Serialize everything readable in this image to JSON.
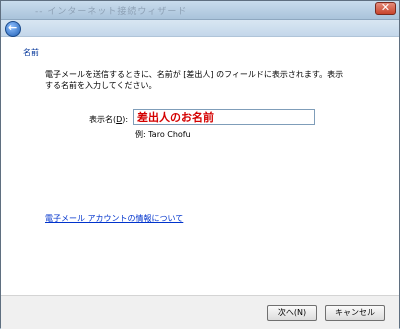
{
  "window": {
    "title_ghost": "-- インターネット接続ウィザード"
  },
  "page": {
    "section_title": "名前",
    "description": "電子メールを送信するときに、名前が [差出人] のフィールドに表示されます。表示する名前を入力してください。",
    "field_label_prefix": "表示名(",
    "field_label_key": "D",
    "field_label_suffix": "):",
    "display_name_value": "差出人のお名前",
    "example_text": "例: Taro Chofu",
    "info_link": "電子メール アカウントの情報について"
  },
  "footer": {
    "next_label": "次へ(N)",
    "cancel_label": "キャンセル"
  },
  "icons": {
    "back": "back-arrow-icon",
    "close": "close-icon"
  },
  "colors": {
    "link": "#0033cc",
    "section_title": "#003399",
    "input_text": "#d40000",
    "close_button": "#c8442c"
  }
}
